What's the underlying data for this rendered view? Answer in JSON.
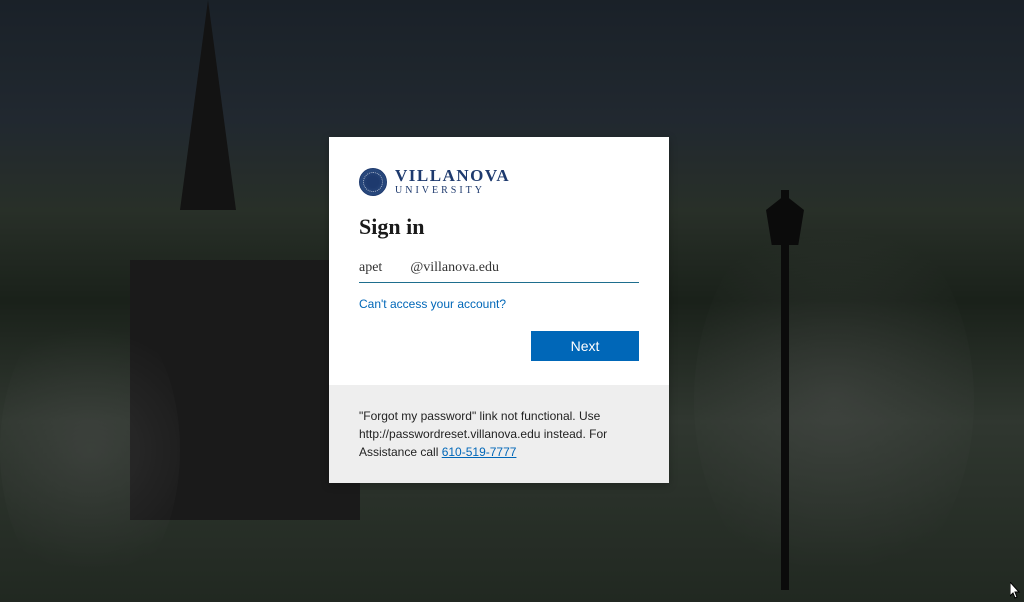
{
  "logo": {
    "main": "VILLANOVA",
    "sub": "UNIVERSITY"
  },
  "signin": {
    "heading": "Sign in",
    "email_value": "apet        @villanova.edu",
    "help_link": "Can't access your account?",
    "next_button": "Next"
  },
  "footer": {
    "text_before": "\"Forgot my password\" link not functional. Use http://passwordreset.villanova.edu instead. For Assistance call ",
    "phone": "610-519-7777"
  }
}
